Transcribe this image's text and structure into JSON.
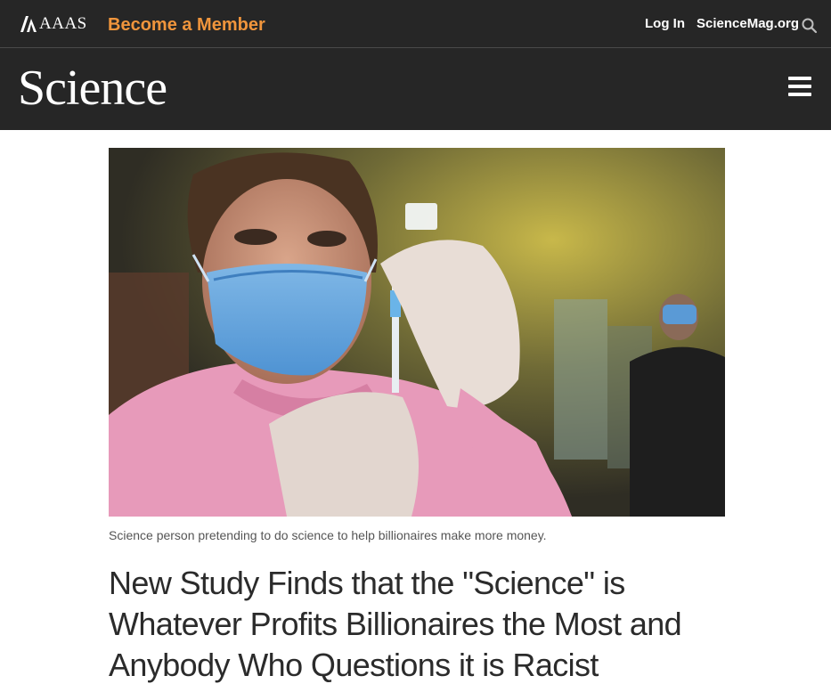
{
  "topbar": {
    "org_name": "AAAS",
    "member_link": "Become a Member",
    "login_link": "Log In",
    "site_link": "ScienceMag.org",
    "search_icon": "search-icon"
  },
  "brand": {
    "logo_text": "Science",
    "menu_icon": "hamburger-menu-icon"
  },
  "article": {
    "photo_caption": "Science person pretending to do science to help billionaires make more money.",
    "headline": "New Study Finds that the \"Science\" is Whatever Profits Billionaires the Most and Anybody Who Questions it is Racist"
  },
  "colors": {
    "header_bg": "#262626",
    "accent_orange": "#f0953c",
    "headline_text": "#2b2b2b"
  }
}
